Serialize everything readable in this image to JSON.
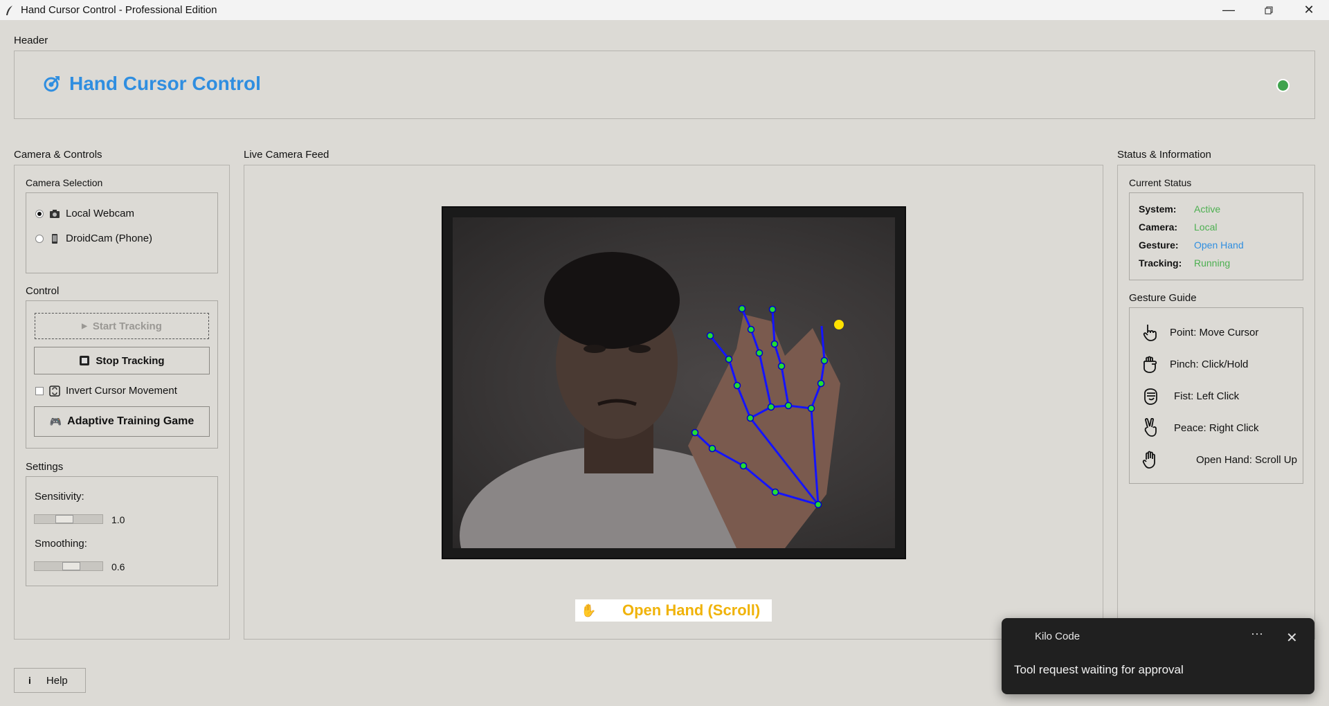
{
  "window": {
    "title": "Hand Cursor Control - Professional Edition",
    "minimize_icon": "minimize-icon",
    "restore_icon": "restore-icon",
    "close_icon": "close-icon"
  },
  "header": {
    "group_label": "Header",
    "title": "Hand Cursor Control",
    "status_color": "#3fa34d"
  },
  "camera_controls": {
    "group_label": "Camera & Controls",
    "camera_selection": {
      "label": "Camera Selection",
      "options": [
        {
          "label": "Local Webcam",
          "selected": true
        },
        {
          "label": "DroidCam (Phone)",
          "selected": false
        }
      ]
    },
    "control": {
      "label": "Control",
      "start_label": "Start Tracking",
      "stop_label": "Stop Tracking",
      "invert_label": "Invert Cursor Movement",
      "invert_checked": false,
      "training_label": "Adaptive Training Game"
    },
    "settings": {
      "label": "Settings",
      "sensitivity_label": "Sensitivity:",
      "sensitivity_value": "1.0",
      "smoothing_label": "Smoothing:",
      "smoothing_value": "0.6"
    }
  },
  "feed": {
    "group_label": "Live Camera Feed",
    "gesture_text": "Open Hand (Scroll)",
    "accent": "#f0b30a"
  },
  "status": {
    "group_label": "Status & Information",
    "current_label": "Current Status",
    "rows": [
      {
        "key": "System:",
        "value": "Active",
        "color": "#4caf50"
      },
      {
        "key": "Camera:",
        "value": "Local",
        "color": "#4caf50"
      },
      {
        "key": "Gesture:",
        "value": "Open Hand",
        "color": "#2f8ee0"
      },
      {
        "key": "Tracking:",
        "value": "Running",
        "color": "#4caf50"
      }
    ],
    "guide_label": "Gesture Guide",
    "guide": [
      {
        "text": "Point: Move Cursor",
        "icon": "pointing-hand-icon"
      },
      {
        "text": "Pinch: Click/Hold",
        "icon": "pinch-hand-icon"
      },
      {
        "text": "Fist: Left Click",
        "icon": "fist-icon"
      },
      {
        "text": "Peace: Right Click",
        "icon": "peace-hand-icon"
      },
      {
        "text": "Open Hand: Scroll Up",
        "icon": "open-hand-icon"
      }
    ]
  },
  "help": {
    "label": "Help"
  },
  "toast": {
    "app_name": "Kilo Code",
    "message": "Tool request waiting for approval",
    "more": "···"
  }
}
